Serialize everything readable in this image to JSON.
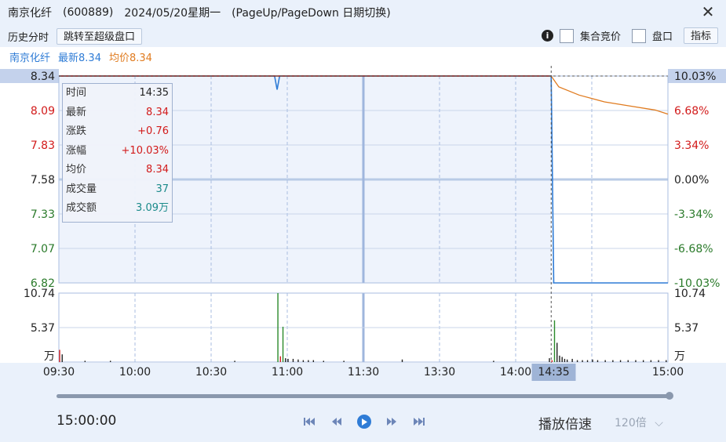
{
  "titlebar": {
    "stock_name": "南京化纤",
    "code": "(600889)",
    "date": "2024/05/20星期一",
    "hint": "(PageUp/PageDown 日期切换)"
  },
  "toolbar": {
    "label": "历史分时",
    "jump_button": "跳转至超级盘口",
    "check_auction": "集合竞价",
    "check_panel": "盘口",
    "indicator_button": "指标"
  },
  "infobar": {
    "name": "南京化纤",
    "latest": "最新8.34",
    "avg": "均价8.34"
  },
  "tooltip": {
    "rows": [
      {
        "k": "时间",
        "v": "14:35",
        "color": "#222222"
      },
      {
        "k": "最新",
        "v": "8.34",
        "color": "#d21a1a"
      },
      {
        "k": "涨跌",
        "v": "+0.76",
        "color": "#d21a1a"
      },
      {
        "k": "涨幅",
        "v": "+10.03%",
        "color": "#d21a1a"
      },
      {
        "k": "均价",
        "v": "8.34",
        "color": "#d21a1a"
      },
      {
        "k": "成交量",
        "v": "37",
        "color": "#1a8a8a"
      },
      {
        "k": "成交额",
        "v": "3.09万",
        "color": "#1a8a8a"
      }
    ]
  },
  "player": {
    "time": "15:00:00",
    "speed_label": "播放倍速",
    "speed_value": "120倍",
    "progress": 1.0
  },
  "colors": {
    "up": "#d21a1a",
    "down": "#2a7a2a",
    "price_line": "#2f7cd6",
    "avg_line": "#e07b1f",
    "grid": "#c9d6ea"
  },
  "chart_data": {
    "type": "line",
    "prev_close": 7.58,
    "price_ticks": [
      "8.34",
      "8.09",
      "7.83",
      "7.58",
      "7.33",
      "7.07",
      "6.82"
    ],
    "pct_ticks": [
      "10.03%",
      "6.68%",
      "3.34%",
      "0.00%",
      "-3.34%",
      "-6.68%",
      "-10.03%"
    ],
    "x_ticks": [
      "09:30",
      "10:00",
      "10:30",
      "11:00",
      "11:30",
      "13:30",
      "14:00",
      "14:35",
      "15:00"
    ],
    "ylim": [
      6.82,
      8.34
    ],
    "volume_ticks": [
      "10.74",
      "5.37",
      "万"
    ],
    "volume_ylim": [
      0,
      10.74
    ],
    "crosshair_time": "14:35",
    "series": [
      {
        "key": "price",
        "points": [
          [
            0,
            8.34
          ],
          [
            85,
            8.34
          ],
          [
            86,
            8.24
          ],
          [
            87,
            8.34
          ],
          [
            194,
            8.34
          ],
          [
            195,
            6.82
          ],
          [
            240,
            6.82
          ]
        ]
      },
      {
        "key": "avg",
        "points": [
          [
            0,
            8.34
          ],
          [
            194,
            8.34
          ],
          [
            197,
            8.26
          ],
          [
            205,
            8.2
          ],
          [
            215,
            8.15
          ],
          [
            225,
            8.12
          ],
          [
            235,
            8.09
          ],
          [
            240,
            8.06
          ]
        ]
      }
    ],
    "volume_bars": [
      {
        "t": 0,
        "v": 1.9,
        "c": "up"
      },
      {
        "t": 1,
        "v": 1.2,
        "c": "down"
      },
      {
        "t": 10,
        "v": 0.2,
        "c": "down"
      },
      {
        "t": 20,
        "v": 0.2,
        "c": "down"
      },
      {
        "t": 69,
        "v": 0.2,
        "c": "down"
      },
      {
        "t": 86,
        "v": 10.74,
        "c": "down"
      },
      {
        "t": 87,
        "v": 0.9,
        "c": "up"
      },
      {
        "t": 88,
        "v": 5.5,
        "c": "down"
      },
      {
        "t": 89,
        "v": 0.6,
        "c": "down"
      },
      {
        "t": 90,
        "v": 0.5,
        "c": "down"
      },
      {
        "t": 92,
        "v": 0.5,
        "c": "down"
      },
      {
        "t": 94,
        "v": 0.4,
        "c": "down"
      },
      {
        "t": 96,
        "v": 0.3,
        "c": "down"
      },
      {
        "t": 98,
        "v": 0.3,
        "c": "down"
      },
      {
        "t": 100,
        "v": 0.3,
        "c": "down"
      },
      {
        "t": 104,
        "v": 0.2,
        "c": "down"
      },
      {
        "t": 112,
        "v": 0.2,
        "c": "down"
      },
      {
        "t": 135,
        "v": 0.4,
        "c": "down"
      },
      {
        "t": 171,
        "v": 0.2,
        "c": "down"
      },
      {
        "t": 193,
        "v": 0.6,
        "c": "down"
      },
      {
        "t": 194,
        "v": 0.3,
        "c": "up"
      },
      {
        "t": 195,
        "v": 6.5,
        "c": "down"
      },
      {
        "t": 196,
        "v": 3.0,
        "c": "down"
      },
      {
        "t": 197,
        "v": 1.0,
        "c": "down"
      },
      {
        "t": 198,
        "v": 0.8,
        "c": "down"
      },
      {
        "t": 199,
        "v": 0.5,
        "c": "down"
      },
      {
        "t": 200,
        "v": 0.4,
        "c": "down"
      },
      {
        "t": 202,
        "v": 0.5,
        "c": "down"
      },
      {
        "t": 204,
        "v": 0.3,
        "c": "down"
      },
      {
        "t": 206,
        "v": 0.3,
        "c": "down"
      },
      {
        "t": 208,
        "v": 0.3,
        "c": "down"
      },
      {
        "t": 210,
        "v": 0.4,
        "c": "down"
      },
      {
        "t": 212,
        "v": 0.3,
        "c": "down"
      },
      {
        "t": 215,
        "v": 0.3,
        "c": "down"
      },
      {
        "t": 218,
        "v": 0.3,
        "c": "down"
      },
      {
        "t": 221,
        "v": 0.3,
        "c": "down"
      },
      {
        "t": 224,
        "v": 0.3,
        "c": "down"
      },
      {
        "t": 227,
        "v": 0.3,
        "c": "down"
      },
      {
        "t": 230,
        "v": 0.3,
        "c": "down"
      },
      {
        "t": 233,
        "v": 0.3,
        "c": "down"
      },
      {
        "t": 236,
        "v": 0.3,
        "c": "down"
      },
      {
        "t": 239,
        "v": 0.3,
        "c": "down"
      }
    ]
  }
}
